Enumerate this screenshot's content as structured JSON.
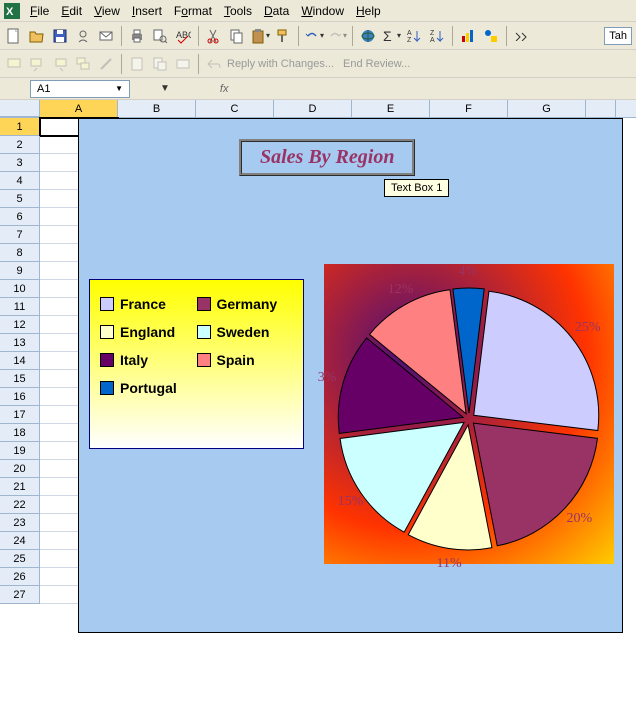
{
  "menu": {
    "items": [
      "File",
      "Edit",
      "View",
      "Insert",
      "Format",
      "Tools",
      "Data",
      "Window",
      "Help"
    ]
  },
  "toolbar2_text": {
    "reply": "Reply with Changes...",
    "end_review": "End Review..."
  },
  "font_name": "Tah",
  "namebox": "A1",
  "fx": "fx",
  "columns": [
    "A",
    "B",
    "C",
    "D",
    "E",
    "F",
    "G"
  ],
  "row_count": 27,
  "active_cell": "A1",
  "chart": {
    "title": "Sales By Region",
    "text_box": "Text Box 1"
  },
  "chart_data": {
    "type": "pie",
    "title": "Sales By Region",
    "series": [
      {
        "name": "France",
        "value": 25,
        "label": "25%",
        "color": "#ccccff"
      },
      {
        "name": "Germany",
        "value": 20,
        "label": "20%",
        "color": "#993366"
      },
      {
        "name": "England",
        "value": 11,
        "label": "11%",
        "color": "#ffffcc"
      },
      {
        "name": "Sweden",
        "value": 15,
        "label": "15%",
        "color": "#ccffff"
      },
      {
        "name": "Italy",
        "value": 13,
        "label": "3%",
        "color": "#660066"
      },
      {
        "name": "Spain",
        "value": 12,
        "label": "12%",
        "color": "#ff8080"
      },
      {
        "name": "Portugal",
        "value": 4,
        "label": "4%",
        "color": "#0066cc"
      }
    ],
    "legend_position": "left"
  }
}
